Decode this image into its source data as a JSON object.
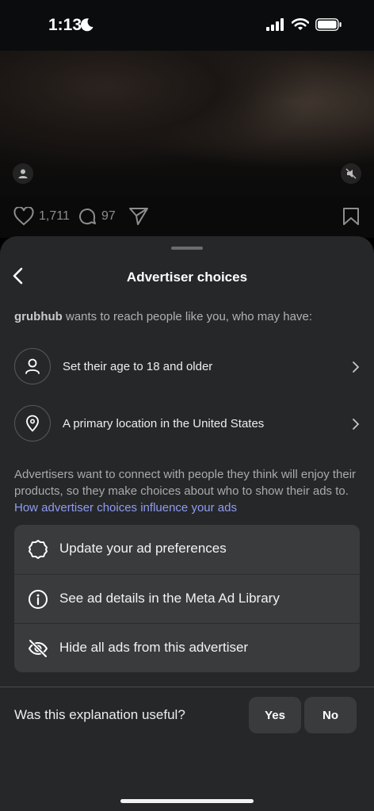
{
  "status_bar": {
    "time": "1:13"
  },
  "post": {
    "likes": "1,711",
    "comments": "97"
  },
  "sheet": {
    "title": "Advertiser choices",
    "intro_advertiser": "grubhub",
    "intro_text": " wants to reach people like you, who may have:",
    "reasons": [
      {
        "icon": "person-icon",
        "label": "Set their age to 18 and older"
      },
      {
        "icon": "location-pin-icon",
        "label": "A primary location in the United States"
      }
    ],
    "explanation": "Advertisers want to connect with people they think will enjoy their products, so they make choices about who to show their ads to. ",
    "explanation_link": "How advertiser choices influence your ads",
    "options": [
      {
        "icon": "gear-icon",
        "label": "Update your ad preferences"
      },
      {
        "icon": "info-icon",
        "label": "See ad details in the Meta Ad Library"
      },
      {
        "icon": "eye-slash-icon",
        "label": "Hide all ads from this advertiser"
      }
    ],
    "feedback": {
      "question": "Was this explanation useful?",
      "yes": "Yes",
      "no": "No"
    }
  },
  "colors": {
    "sheet_bg": "#262729",
    "card_bg": "#3a3b3d",
    "link": "#8e9cf3"
  }
}
